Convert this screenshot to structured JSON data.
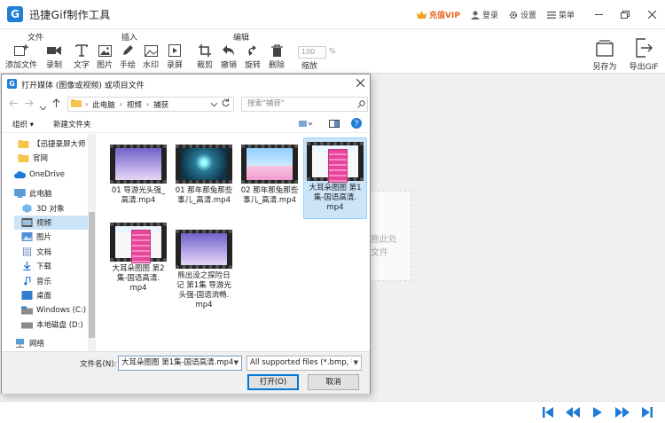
{
  "app": {
    "title": "迅捷Gif制作工具",
    "vip": "充值VIP",
    "login": "登录",
    "settings": "设置",
    "menu": "菜单"
  },
  "ribbon": {
    "file_group": "文件",
    "insert_group": "插入",
    "edit_group": "编辑",
    "add_file": "添加文件",
    "record": "录制",
    "text": "文字",
    "image": "图片",
    "freehand": "手绘",
    "watermark": "水印",
    "screen_record": "录屏",
    "crop": "裁剪",
    "undo": "撤销",
    "rotate": "旋转",
    "delete": "删除",
    "zoom_value": "100",
    "zoom_unit": "%",
    "zoom_label": "缩放",
    "save_as": "另存为",
    "export_gif": "导出GIF"
  },
  "background": {
    "drop_line1": "拖此处",
    "drop_line2": "文件"
  },
  "dialog": {
    "title": "打开媒体 (图像或视频) 或项目文件",
    "breadcrumb": [
      "此电脑",
      "视频",
      "捕获"
    ],
    "search_placeholder": "搜索\"捕获\"",
    "organize": "组织 ▾",
    "new_folder": "新建文件夹",
    "nav_items": [
      {
        "label": "【迅捷录屏大师",
        "icon": "folder-icon"
      },
      {
        "label": "官网",
        "icon": "folder-icon"
      },
      {
        "label": "OneDrive",
        "icon": "cloud-icon"
      },
      {
        "label": "此电脑",
        "icon": "computer-icon"
      },
      {
        "label": "3D 对象",
        "icon": "cube-icon"
      },
      {
        "label": "视频",
        "icon": "video-folder-icon",
        "selected": true
      },
      {
        "label": "图片",
        "icon": "pictures-icon"
      },
      {
        "label": "文档",
        "icon": "documents-icon"
      },
      {
        "label": "下载",
        "icon": "download-icon"
      },
      {
        "label": "音乐",
        "icon": "music-icon"
      },
      {
        "label": "桌面",
        "icon": "desktop-icon"
      },
      {
        "label": "Windows (C:)",
        "icon": "drive-icon"
      },
      {
        "label": "本地磁盘 (D:)",
        "icon": "drive-icon"
      },
      {
        "label": "网络",
        "icon": "network-icon"
      }
    ],
    "files": [
      {
        "name": "01 导游光头强_高清.mp4",
        "lines": [
          "01 导游光头强_",
          "高清.mp4"
        ],
        "thumb": "sky"
      },
      {
        "name": "01 那年那兔那些事儿_高清.mp4",
        "lines": [
          "01 那年那兔那些",
          "事儿_高清.mp4"
        ],
        "thumb": "blue"
      },
      {
        "name": "02 那年那兔那些事儿_高清.mp4",
        "lines": [
          "02 那年那兔那些",
          "事儿_高清.mp4"
        ],
        "thumb": "bear"
      },
      {
        "name": "大耳朵图图 第1集-国语高清.mp4",
        "lines": [
          "大耳朵图图 第1",
          "集-国语高清.",
          "mp4"
        ],
        "thumb": "pink",
        "selected": true
      },
      {
        "name": "大耳朵图图 第2集-国语高清.mp4",
        "lines": [
          "大耳朵图图 第2",
          "集-国语高清.",
          "mp4"
        ],
        "thumb": "pink"
      },
      {
        "name": "熊出没之探险日记 第1集 导游光头强-国语流畅.mp4",
        "lines": [
          "熊出没之探险日",
          "记 第1集 导游光",
          "头强-国语流畅.",
          "mp4"
        ],
        "thumb": "sky"
      }
    ],
    "filename_label": "文件名(N):",
    "filename_value": "大耳朵图图 第1集-国语高清.mp4",
    "filetype_value": "All supported files (*.bmp, *.",
    "open_button": "打开(O)",
    "cancel_button": "取消"
  },
  "colors": {
    "accent": "#1f7ed6",
    "vip": "#e8631a",
    "selection": "#cce4f7",
    "nav_blue": "#1e7bd6"
  }
}
